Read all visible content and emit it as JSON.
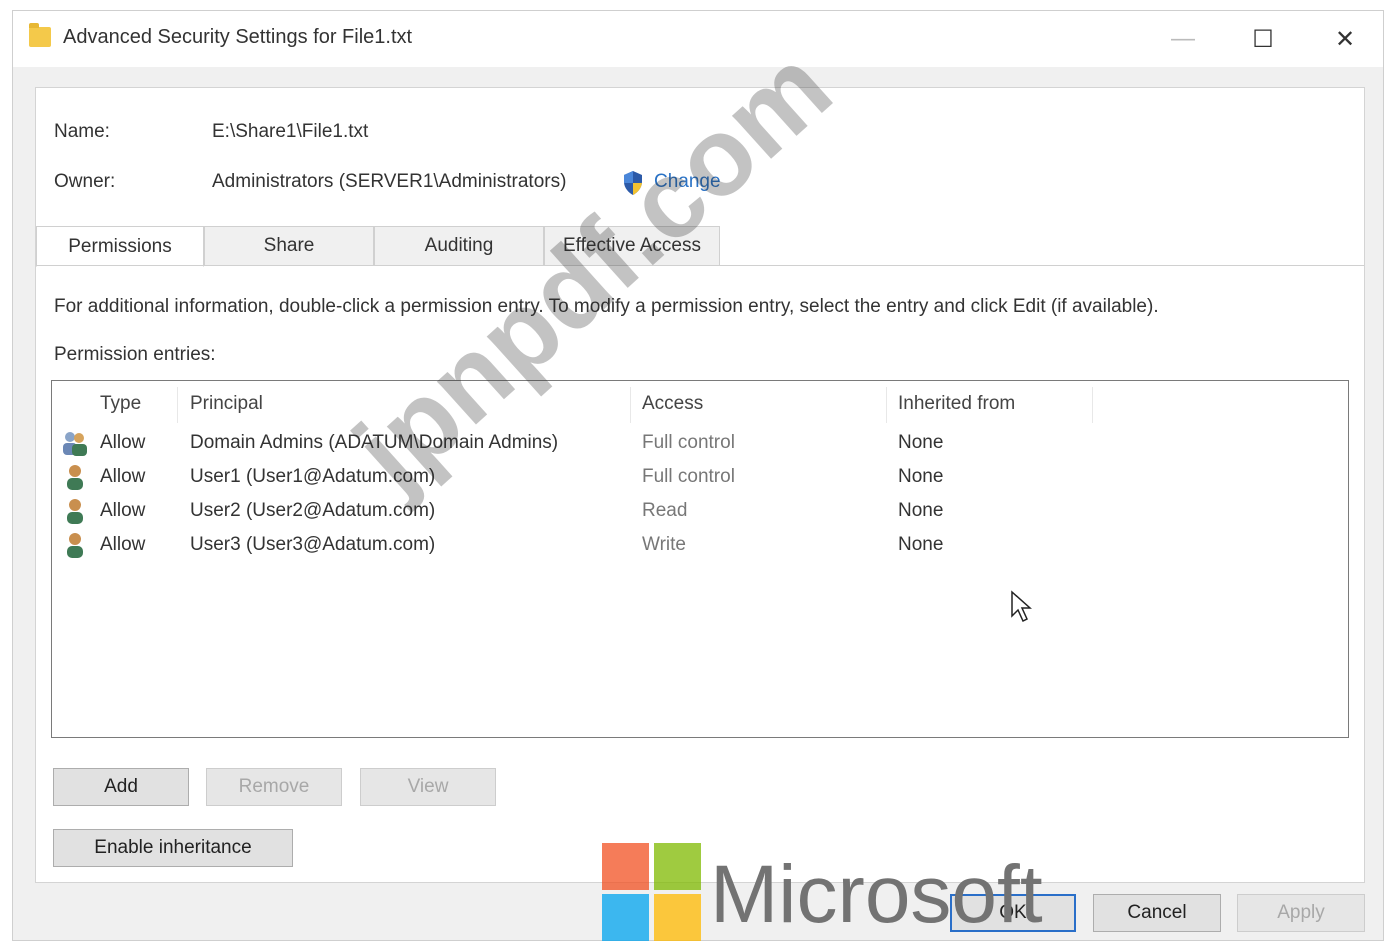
{
  "window": {
    "title": "Advanced Security Settings for File1.txt",
    "controls": {
      "minimize": "—",
      "maximize": "☐",
      "close": "✕"
    }
  },
  "details": {
    "name_label": "Name:",
    "name_value": "E:\\Share1\\File1.txt",
    "owner_label": "Owner:",
    "owner_value": "Administrators (SERVER1\\Administrators)",
    "change_link": "Change"
  },
  "tabs": [
    {
      "label": "Permissions",
      "active": true
    },
    {
      "label": "Share"
    },
    {
      "label": "Auditing"
    },
    {
      "label": "Effective Access"
    }
  ],
  "info_text": "For additional information, double-click a permission entry. To modify a permission entry, select the entry and click Edit (if available).",
  "entries_label": "Permission entries:",
  "table": {
    "headers": [
      "Type",
      "Principal",
      "Access",
      "Inherited from"
    ],
    "rows": [
      {
        "icon": "group-icon",
        "type": "Allow",
        "principal": "Domain Admins (ADATUM\\Domain Admins)",
        "access": "Full control",
        "inherited": "None"
      },
      {
        "icon": "user-icon",
        "type": "Allow",
        "principal": "User1 (User1@Adatum.com)",
        "access": "Full control",
        "inherited": "None"
      },
      {
        "icon": "user-icon",
        "type": "Allow",
        "principal": "User2 (User2@Adatum.com)",
        "access": "Read",
        "inherited": "None"
      },
      {
        "icon": "user-icon",
        "type": "Allow",
        "principal": "User3 (User3@Adatum.com)",
        "access": "Write",
        "inherited": "None"
      }
    ]
  },
  "buttons": {
    "add": "Add",
    "remove": "Remove",
    "view": "View",
    "enable_inheritance": "Enable inheritance",
    "ok": "OK",
    "cancel": "Cancel",
    "apply": "Apply"
  },
  "overlays": {
    "watermark": "jpnpdf.com",
    "brand_text": "Microsoft",
    "brand_colors": [
      "#f25022",
      "#7fba00",
      "#00a4ef",
      "#ffb900"
    ]
  }
}
